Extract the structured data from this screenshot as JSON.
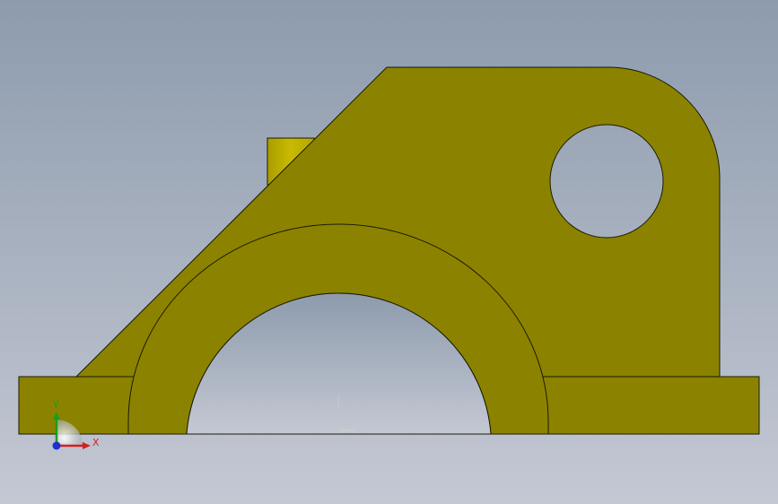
{
  "viewport": {
    "background_top_color": "#8d9bad",
    "background_bottom_color": "#c4c8d3",
    "part_color": "#8b8300",
    "part_side_color": "#bdb000",
    "edge_color": "#1a1a00"
  },
  "triad": {
    "x_label": "X",
    "y_label": "Y",
    "x_color": "#d42020",
    "y_color": "#18a018",
    "z_color": "#2030d0"
  }
}
